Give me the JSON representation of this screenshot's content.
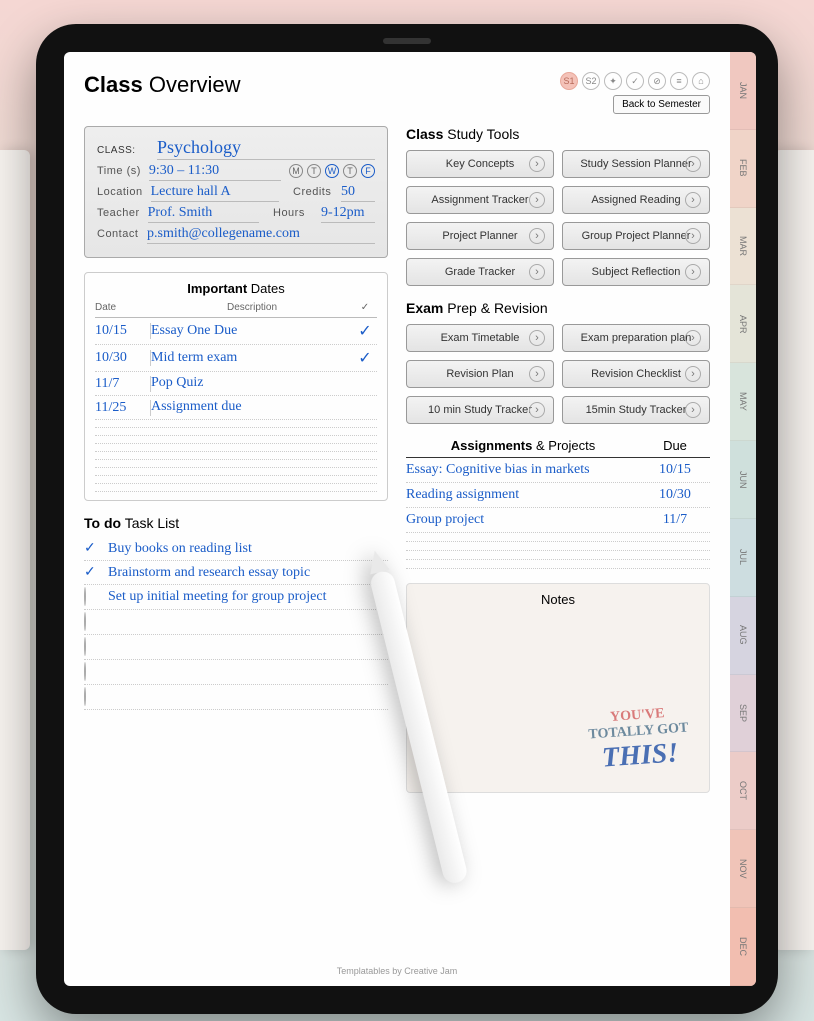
{
  "header": {
    "title_bold": "Class",
    "title_light": "Overview",
    "back_label": "Back to Semester",
    "top_icons": [
      "S1",
      "S2",
      "✦",
      "✓",
      "⊘",
      "≡",
      "⌂"
    ]
  },
  "class_info": {
    "class_label": "CLASS:",
    "class_value": "Psychology",
    "time_label": "Time (s)",
    "time_value": "9:30 – 11:30",
    "days": [
      "M",
      "T",
      "W",
      "T",
      "F"
    ],
    "days_on": [
      false,
      false,
      true,
      false,
      true
    ],
    "location_label": "Location",
    "location_value": "Lecture hall A",
    "credits_label": "Credits",
    "credits_value": "50",
    "teacher_label": "Teacher",
    "teacher_value": "Prof. Smith",
    "hours_label": "Hours",
    "hours_value": "9-12pm",
    "contact_label": "Contact",
    "contact_value": "p.smith@collegename.com"
  },
  "dates": {
    "title_bold": "Important",
    "title_light": "Dates",
    "head_date": "Date",
    "head_desc": "Description",
    "head_check": "✓",
    "rows": [
      {
        "date": "10/15",
        "desc": "Essay One Due",
        "done": true
      },
      {
        "date": "10/30",
        "desc": "Mid term exam",
        "done": true
      },
      {
        "date": "11/7",
        "desc": "Pop Quiz",
        "done": false
      },
      {
        "date": "11/25",
        "desc": "Assignment due",
        "done": false
      },
      {
        "date": "",
        "desc": "",
        "done": false
      },
      {
        "date": "",
        "desc": "",
        "done": false
      },
      {
        "date": "",
        "desc": "",
        "done": false
      },
      {
        "date": "",
        "desc": "",
        "done": false
      },
      {
        "date": "",
        "desc": "",
        "done": false
      },
      {
        "date": "",
        "desc": "",
        "done": false
      },
      {
        "date": "",
        "desc": "",
        "done": false
      },
      {
        "date": "",
        "desc": "",
        "done": false
      },
      {
        "date": "",
        "desc": "",
        "done": false
      }
    ]
  },
  "todo": {
    "title_bold": "To do",
    "title_light": "Task List",
    "rows": [
      {
        "text": "Buy books on reading list",
        "done": true
      },
      {
        "text": "Brainstorm and research essay topic",
        "done": true
      },
      {
        "text": "Set up initial meeting for group project",
        "done": false
      },
      {
        "text": "",
        "done": false
      },
      {
        "text": "",
        "done": false
      },
      {
        "text": "",
        "done": false
      },
      {
        "text": "",
        "done": false
      }
    ]
  },
  "tools": {
    "title_bold": "Class",
    "title_light": "Study Tools",
    "items": [
      "Key Concepts",
      "Study Session Planner",
      "Assignment Tracker",
      "Assigned Reading",
      "Project Planner",
      "Group Project Planner",
      "Grade Tracker",
      "Subject Reflection"
    ]
  },
  "exam": {
    "title_bold": "Exam",
    "title_light": "Prep & Revision",
    "items": [
      "Exam Timetable",
      "Exam preparation plan",
      "Revision Plan",
      "Revision Checklist",
      "10 min Study Tracker",
      "15min Study Tracker"
    ]
  },
  "assignments": {
    "title_bold": "Assignments",
    "title_light": "& Projects",
    "due_label": "Due",
    "rows": [
      {
        "name": "Essay: Cognitive bias in markets",
        "due": "10/15"
      },
      {
        "name": "Reading assignment",
        "due": "10/30"
      },
      {
        "name": "Group project",
        "due": "11/7"
      },
      {
        "name": "",
        "due": ""
      },
      {
        "name": "",
        "due": ""
      },
      {
        "name": "",
        "due": ""
      },
      {
        "name": "",
        "due": ""
      }
    ]
  },
  "notes": {
    "title": "Notes",
    "sticker_l1": "YOU'VE",
    "sticker_l2": "TOTALLY GOT",
    "sticker_l3": "THIS!"
  },
  "footer": "Templatables by Creative Jam",
  "side_tabs": [
    "JAN",
    "FEB",
    "MAR",
    "APR",
    "MAY",
    "JUN",
    "JUL",
    "AUG",
    "SEP",
    "OCT",
    "NOV",
    "DEC"
  ]
}
